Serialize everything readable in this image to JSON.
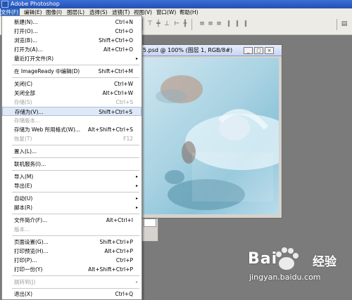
{
  "app": {
    "title": "Adobe Photoshop"
  },
  "menubar": [
    {
      "label": "文件(F)"
    },
    {
      "label": "编辑(E)"
    },
    {
      "label": "图像(I)"
    },
    {
      "label": "图层(L)"
    },
    {
      "label": "选择(S)"
    },
    {
      "label": "滤镜(T)"
    },
    {
      "label": "视图(V)"
    },
    {
      "label": "窗口(W)"
    },
    {
      "label": "帮助(H)"
    }
  ],
  "document": {
    "title": "5.psd @ 100% (图层 1, RGB/8#)",
    "btn_min": "_",
    "btn_max": "□",
    "btn_close": "×"
  },
  "file_menu": {
    "items": [
      {
        "label": "新建(N)...",
        "shortcut": "Ctrl+N"
      },
      {
        "label": "打开(O)...",
        "shortcut": "Ctrl+O"
      },
      {
        "label": "浏览(B)...",
        "shortcut": "Shift+Ctrl+O"
      },
      {
        "label": "打开为(A)...",
        "shortcut": "Alt+Ctrl+O"
      },
      {
        "label": "最近打开文件(R)",
        "shortcut": ""
      },
      {
        "label": "在 ImageReady 中编辑(D)",
        "shortcut": "Shift+Ctrl+M"
      },
      {
        "label": "关闭(C)",
        "shortcut": "Ctrl+W"
      },
      {
        "label": "关闭全部",
        "shortcut": "Alt+Ctrl+W"
      },
      {
        "label": "存储(S)",
        "shortcut": "Ctrl+S"
      },
      {
        "label": "存储为(V)...",
        "shortcut": "Shift+Ctrl+S"
      },
      {
        "label": "存储版本...",
        "shortcut": ""
      },
      {
        "label": "存储为 Web 所用格式(W)...",
        "shortcut": "Alt+Shift+Ctrl+S"
      },
      {
        "label": "恢复(T)",
        "shortcut": "F12"
      },
      {
        "label": "置入(L)...",
        "shortcut": ""
      },
      {
        "label": "联机服务(I)...",
        "shortcut": ""
      },
      {
        "label": "导入(M)",
        "shortcut": ""
      },
      {
        "label": "导出(E)",
        "shortcut": ""
      },
      {
        "label": "自动(U)",
        "shortcut": ""
      },
      {
        "label": "脚本(R)",
        "shortcut": ""
      },
      {
        "label": "文件简介(F)...",
        "shortcut": "Alt+Ctrl+I"
      },
      {
        "label": "版本...",
        "shortcut": ""
      },
      {
        "label": "页面设置(G)...",
        "shortcut": "Shift+Ctrl+P"
      },
      {
        "label": "打印预览(H)...",
        "shortcut": "Alt+Ctrl+P"
      },
      {
        "label": "打印(P)...",
        "shortcut": "Ctrl+P"
      },
      {
        "label": "打印一份(Y)",
        "shortcut": "Alt+Shift+Ctrl+P"
      },
      {
        "label": "跳转到(J)",
        "shortcut": ""
      },
      {
        "label": "退出(X)",
        "shortcut": "Ctrl+Q"
      }
    ]
  },
  "watermark": {
    "brand": "Bai",
    "brand_du": "经验",
    "site": "jingyan.baidu.com"
  },
  "icons": {
    "submenu_arrow": "▸"
  },
  "colors": {
    "menu_highlight": "#316ac5",
    "hover_row": "#dfe9f6",
    "title_bar": "#2c5cc5"
  }
}
